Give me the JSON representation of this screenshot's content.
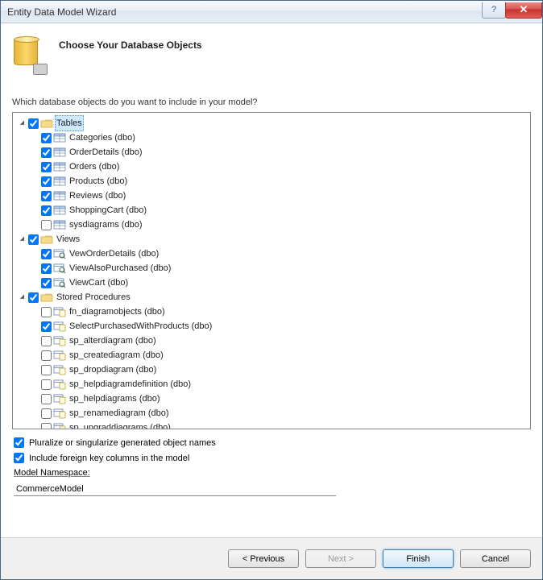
{
  "window": {
    "title": "Entity Data Model Wizard"
  },
  "header": {
    "heading": "Choose Your Database Objects"
  },
  "question": "Which database objects do you want to include in your model?",
  "tree": {
    "tables": {
      "label": "Tables",
      "selected": true,
      "checked": true,
      "items": [
        {
          "label": "Categories (dbo)",
          "checked": true
        },
        {
          "label": "OrderDetails (dbo)",
          "checked": true
        },
        {
          "label": "Orders (dbo)",
          "checked": true
        },
        {
          "label": "Products (dbo)",
          "checked": true
        },
        {
          "label": "Reviews (dbo)",
          "checked": true
        },
        {
          "label": "ShoppingCart (dbo)",
          "checked": true
        },
        {
          "label": "sysdiagrams (dbo)",
          "checked": false
        }
      ]
    },
    "views": {
      "label": "Views",
      "checked": true,
      "items": [
        {
          "label": "VewOrderDetails (dbo)",
          "checked": true
        },
        {
          "label": "ViewAlsoPurchased (dbo)",
          "checked": true
        },
        {
          "label": "ViewCart (dbo)",
          "checked": true
        }
      ]
    },
    "procs": {
      "label": "Stored Procedures",
      "checked": true,
      "items": [
        {
          "label": "fn_diagramobjects (dbo)",
          "checked": false
        },
        {
          "label": "SelectPurchasedWithProducts (dbo)",
          "checked": true
        },
        {
          "label": "sp_alterdiagram (dbo)",
          "checked": false
        },
        {
          "label": "sp_creatediagram (dbo)",
          "checked": false
        },
        {
          "label": "sp_dropdiagram (dbo)",
          "checked": false
        },
        {
          "label": "sp_helpdiagramdefinition (dbo)",
          "checked": false
        },
        {
          "label": "sp_helpdiagrams (dbo)",
          "checked": false
        },
        {
          "label": "sp_renamediagram (dbo)",
          "checked": false
        },
        {
          "label": "sp_upgraddiagrams (dbo)",
          "checked": false
        }
      ]
    }
  },
  "options": {
    "pluralize": {
      "label": "Pluralize or singularize generated object names",
      "checked": true
    },
    "foreignKeys": {
      "label": "Include foreign key columns in the model",
      "checked": true
    }
  },
  "namespace": {
    "label": "Model Namespace:",
    "value": "CommerceModel"
  },
  "buttons": {
    "previous": "< Previous",
    "next": "Next >",
    "finish": "Finish",
    "cancel": "Cancel"
  }
}
